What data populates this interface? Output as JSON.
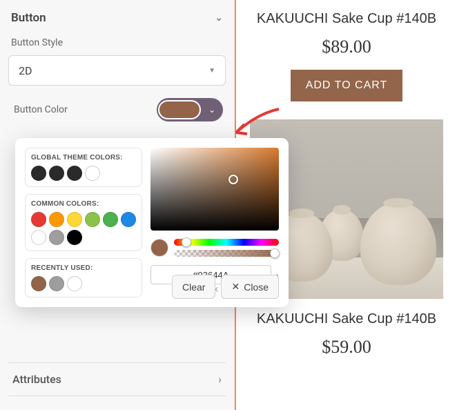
{
  "sidebar": {
    "panel_title": "Button",
    "style_label": "Button Style",
    "style_value": "2D",
    "color_label": "Button Color",
    "color_value": "#93644A",
    "attributes_label": "Attributes"
  },
  "picker": {
    "global_label": "GLOBAL THEME COLORS:",
    "global_colors": [
      "#2a2a2a",
      "#2a2a2a",
      "#2a2a2a",
      "#ffffff"
    ],
    "common_label": "COMMON COLORS:",
    "common_colors": [
      "#e53935",
      "#ff9800",
      "#fdd835",
      "#8bc34a",
      "#4caf50",
      "#1e88e5",
      "#ffffff",
      "#9e9e9e",
      "#000000"
    ],
    "recent_label": "RECENTLY USED:",
    "recent_colors": [
      "#93644A",
      "#9e9e9e",
      "#ffffff"
    ],
    "hex_value": "#93644A",
    "hex_label": "HEX",
    "clear_label": "Clear",
    "close_label": "Close"
  },
  "preview": {
    "product1_title": "KAKUUCHI Sake Cup #140B",
    "product1_price": "$89.00",
    "add_to_cart": "ADD TO CART",
    "product2_title": "KAKUUCHI Sake Cup #140B",
    "product2_price": "$59.00"
  }
}
